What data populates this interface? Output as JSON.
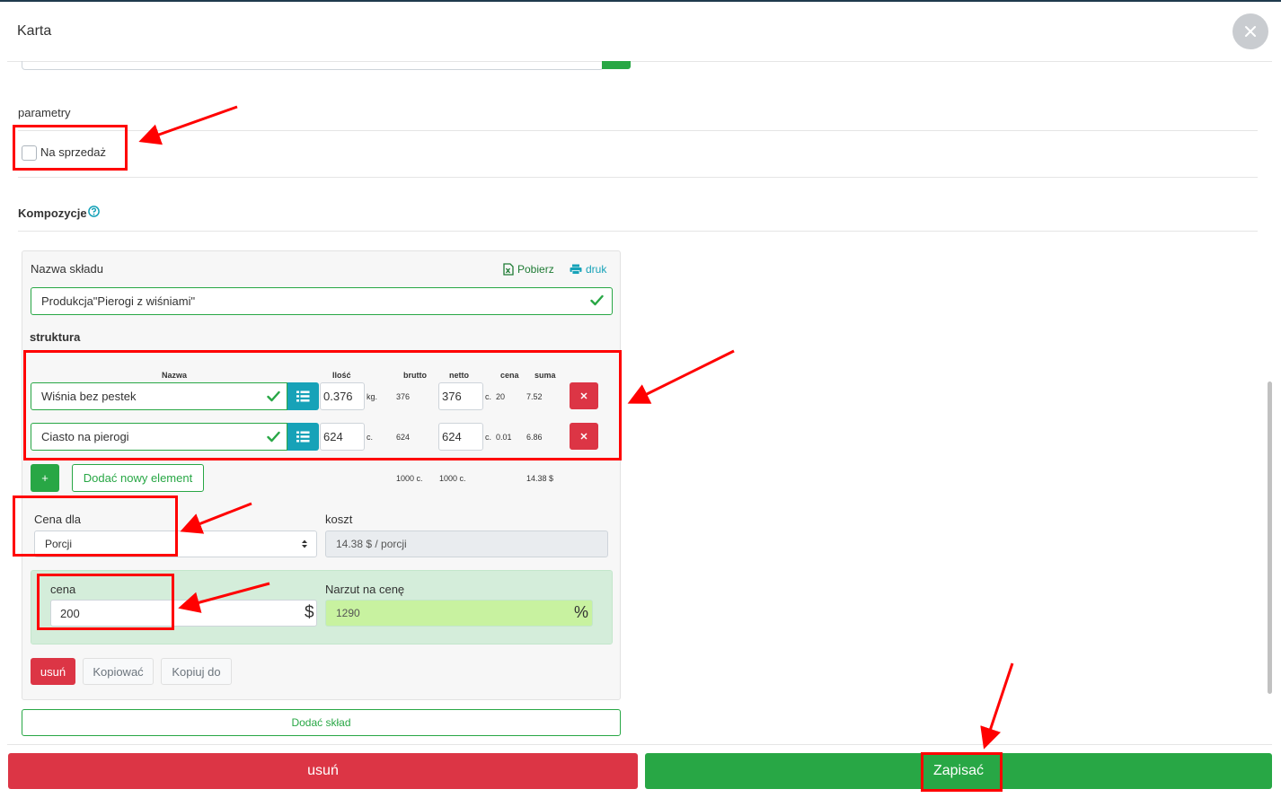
{
  "modal": {
    "title": "Karta"
  },
  "parametry": {
    "label": "parametry",
    "checkbox_label": "Na sprzedaż",
    "checked": false
  },
  "kompozycje": {
    "label": "Kompozycje"
  },
  "composition": {
    "name_label": "Nazwa składu",
    "export_label": "Pobierz",
    "print_label": "druk",
    "name_value": "Produkcja\"Pierogi z wiśniami\"",
    "structure_label": "struktura",
    "columns": {
      "nazwa": "Nazwa",
      "ilosc": "Ilość",
      "brutto": "brutto",
      "netto": "netto",
      "cena": "cena",
      "suma": "suma"
    },
    "rows": [
      {
        "name": "Wiśnia bez pestek",
        "qty": "0.376",
        "qty_unit": "kg.",
        "brutto": "376",
        "netto": "376",
        "netto_unit": "c.",
        "price": "20",
        "sum": "7.52"
      },
      {
        "name": "Ciasto na pierogi",
        "qty": "624",
        "qty_unit": "c.",
        "brutto": "624",
        "netto": "624",
        "netto_unit": "c.",
        "price": "0.01",
        "sum": "6.86"
      }
    ],
    "add_icon": "+",
    "add_element_label": "Dodać nowy element",
    "totals": {
      "brutto": "1000 c.",
      "netto": "1000 c.",
      "sum": "14.38 $"
    },
    "price_for_label": "Cena dla",
    "price_for_value": "Porcji",
    "cost_label": "koszt",
    "cost_value": "14.38 $ / porcji",
    "price_label": "cena",
    "price_value": "200",
    "currency": "$",
    "markup_label": "Narzut na cenę",
    "markup_value": "1290",
    "percent": "%",
    "delete_label": "usuń",
    "copy_label": "Kopiować",
    "copy_to_label": "Kopiuj do"
  },
  "add_composition_label": "Dodać skład",
  "footer": {
    "delete_label": "usuń",
    "save_label": "Zapisać"
  },
  "colors": {
    "success": "#28a745",
    "danger": "#dc3545",
    "info": "#17a2b8",
    "annotation": "#ff0000"
  }
}
